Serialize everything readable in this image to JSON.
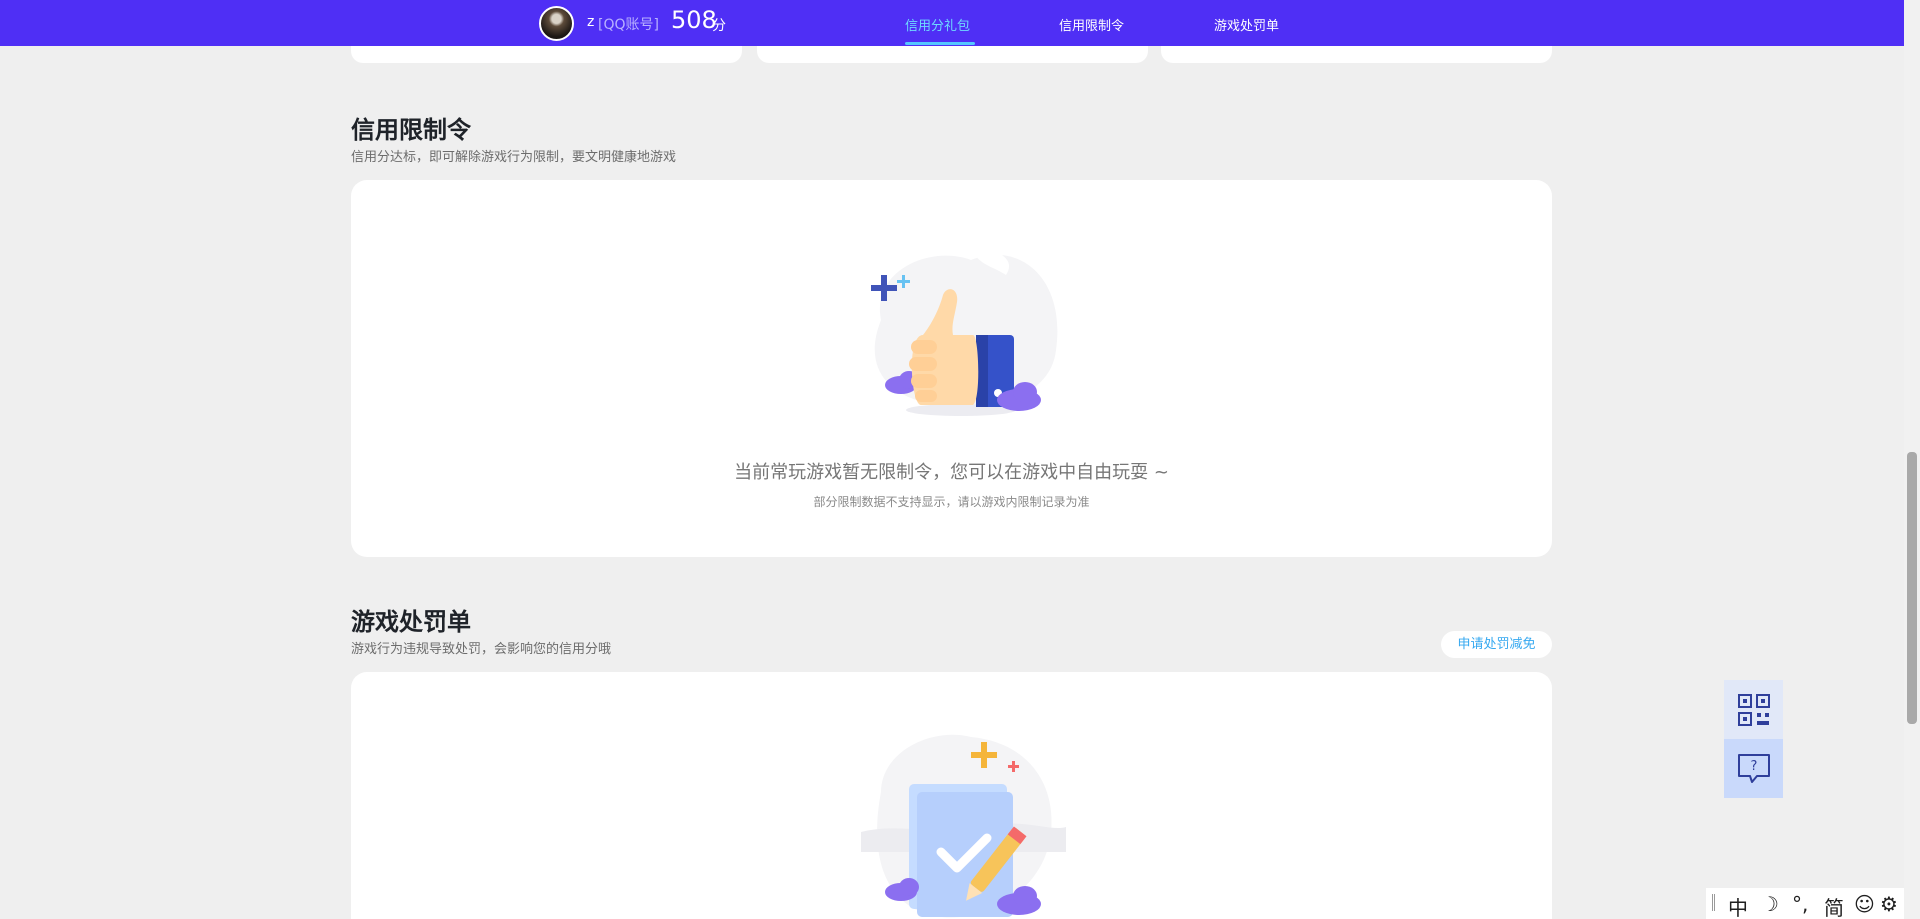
{
  "header": {
    "username": "z",
    "account_type": "[QQ账号]",
    "score": "508",
    "score_unit": "分",
    "tabs": [
      {
        "label": "信用分礼包",
        "active": true
      },
      {
        "label": "信用限制令",
        "active": false
      },
      {
        "label": "游戏处罚单",
        "active": false
      }
    ],
    "bg_color": "#4f2ff5",
    "active_tab_color": "#6ed9ff"
  },
  "restriction": {
    "title": "信用限制令",
    "subtitle": "信用分达标，即可解除游戏行为限制，要文明健康地游戏",
    "empty_text": "当前常玩游戏暂无限制令，您可以在游戏中自由玩耍 ~",
    "note": "部分限制数据不支持显示，请以游戏内限制记录为准",
    "illustration": "thumbs-up-icon"
  },
  "penalty": {
    "title": "游戏处罚单",
    "subtitle": "游戏行为违规导致处罚，会影响您的信用分哦",
    "apply_button": "申请处罚减免",
    "illustration": "document-check-icon"
  },
  "side_tools": [
    {
      "icon": "qr-code-icon"
    },
    {
      "icon": "help-chat-icon"
    }
  ],
  "ime_bar": {
    "lang": "中",
    "moon": "☽",
    "punct": "°,",
    "script": "简",
    "emoji": "☺",
    "settings": "⚙"
  }
}
